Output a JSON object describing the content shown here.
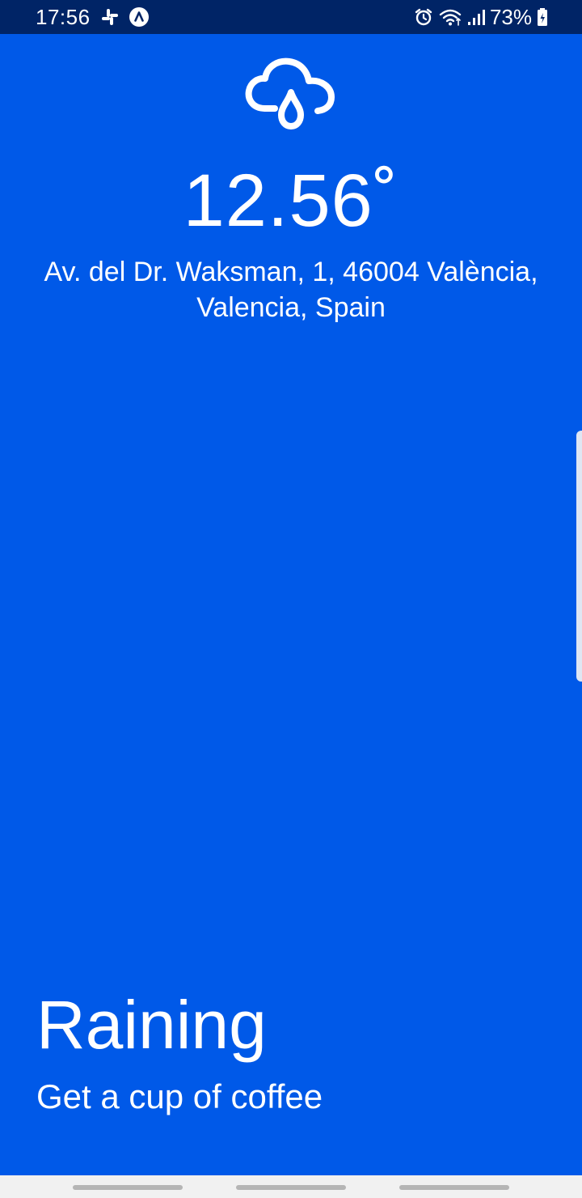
{
  "status_bar": {
    "time": "17:56",
    "battery_percent": "73%",
    "icons": [
      "slack-icon",
      "navigation-app-icon",
      "alarm-icon",
      "wifi-icon",
      "signal-icon",
      "battery-charging-icon"
    ],
    "background_color": "#002466"
  },
  "weather": {
    "icon": "cloud-rain-icon",
    "temperature": "12.56˚",
    "address": "Av. del Dr. Waksman, 1, 46004 València, Valencia, Spain",
    "condition": "Raining",
    "advice": "Get a cup of coffee",
    "background_color": "#0059E8"
  }
}
